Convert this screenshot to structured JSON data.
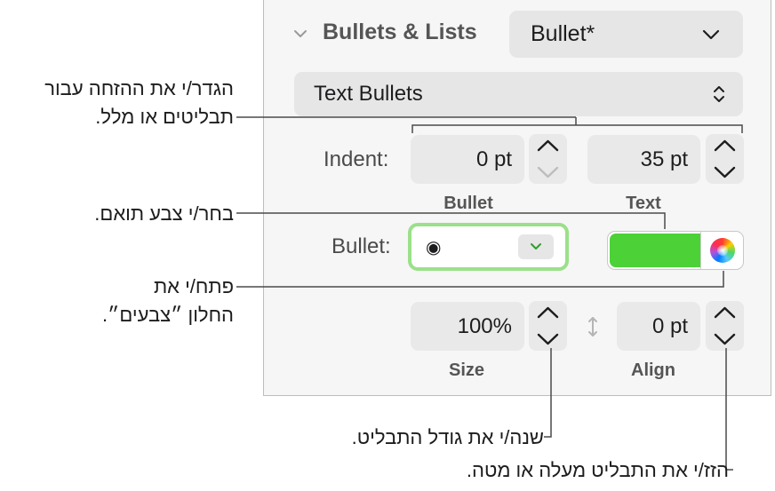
{
  "panel": {
    "section_title": "Bullets & Lists",
    "list_style_value": "Bullet*",
    "bullet_type_value": "Text Bullets",
    "indent_label": "Indent:",
    "indent_bullet_value": "0 pt",
    "indent_text_value": "35 pt",
    "indent_bullet_caption": "Bullet",
    "indent_text_caption": "Text",
    "bullet_label": "Bullet:",
    "bullet_char": "◉",
    "bullet_color": "#4cd137",
    "size_value": "100%",
    "size_caption": "Size",
    "align_value": "0 pt",
    "align_caption": "Align"
  },
  "callouts": {
    "indent_line1": "הגדר/י את ההזחה עבור",
    "indent_line2": "תבליטים או מלל.",
    "color_line1": "בחר/י צבע תואם.",
    "colors_window_line1": "פתח/י את",
    "colors_window_line2": "החלון ״צבעים״.",
    "size_line1": "שנה/י את גודל התבליט.",
    "align_line1": "הזז/י את התבליט מעלה או מטה."
  },
  "icons": {
    "section_chevron": "chevron-down-icon",
    "list_style_chevron": "chevron-down-icon",
    "bullet_type_updown": "chevron-updown-icon",
    "color_wheel": "color-wheel-icon",
    "align_arrow": "vertical-arrows-icon"
  }
}
